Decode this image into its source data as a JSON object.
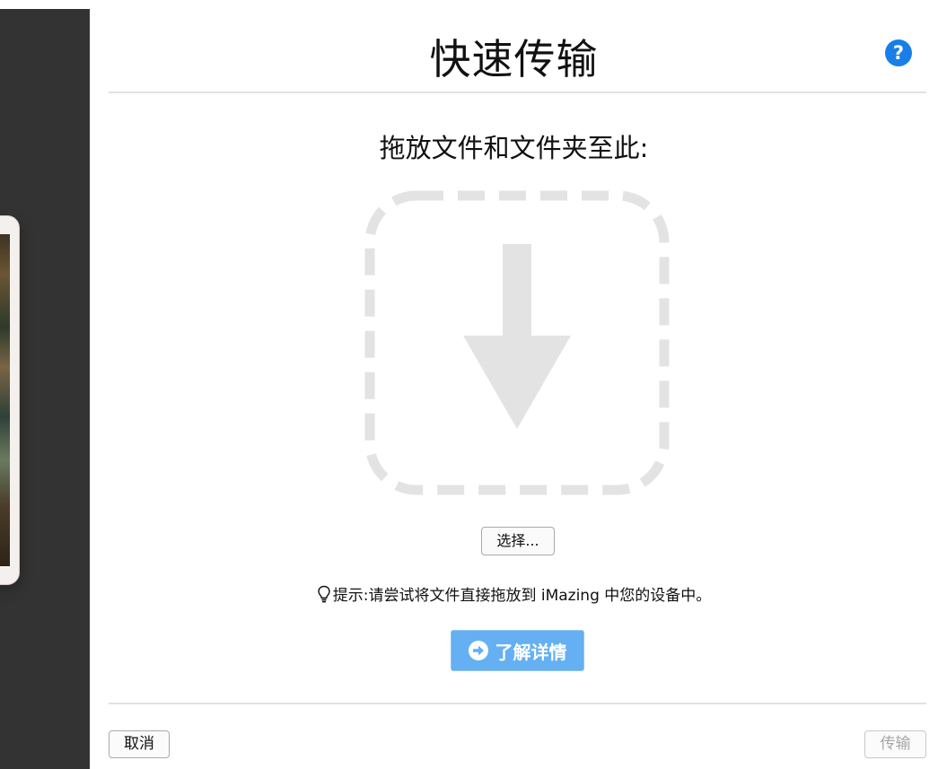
{
  "header": {
    "title": "快速传输",
    "help_label": "?"
  },
  "drop_area": {
    "label": "拖放文件和文件夹至此:"
  },
  "choose_button": {
    "label": "选择..."
  },
  "tip": {
    "text": "提示:请尝试将文件直接拖放到 iMazing 中您的设备中。"
  },
  "learn_more": {
    "label": "了解详情"
  },
  "footer": {
    "cancel_label": "取消",
    "transfer_label": "传输"
  },
  "icons": [
    "question-icon",
    "download-arrow-icon",
    "lightbulb-icon",
    "arrow-right-circle-icon"
  ],
  "colors": {
    "accent_blue": "#1a7ee8",
    "learn_button": "#64b0f2",
    "drop_zone": "#e3e3e3",
    "left_panel": "#333333",
    "disabled_text": "#a6a6a6"
  }
}
